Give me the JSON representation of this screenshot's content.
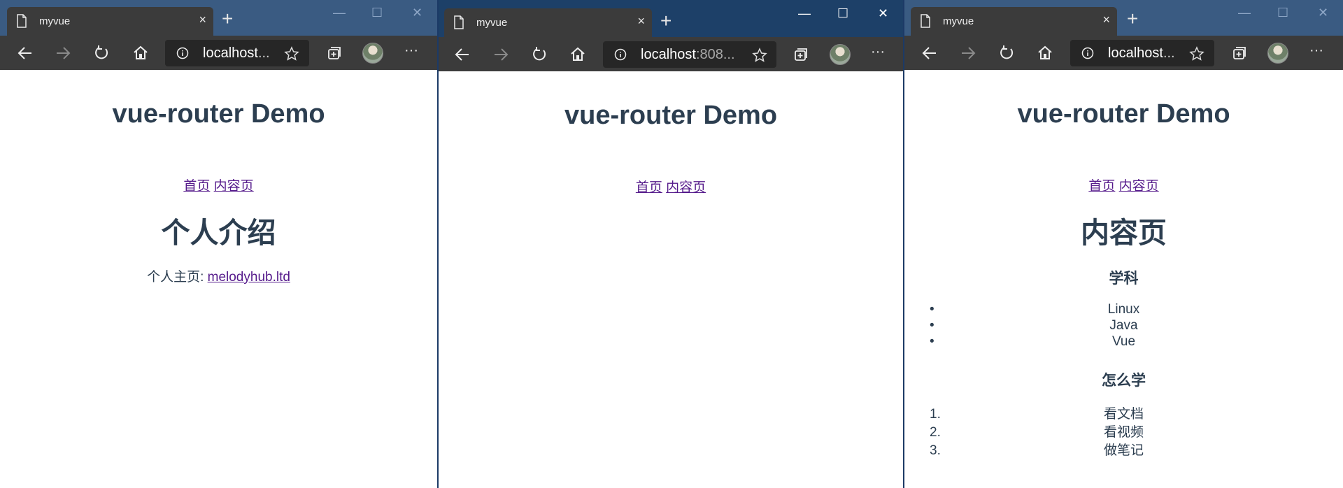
{
  "browser": {
    "tab_title": "myvue",
    "new_tab_symbol": "+",
    "tab_close_symbol": "×",
    "window_controls": {
      "minimize": "—",
      "maximize": "☐",
      "close": "✕"
    },
    "more_symbol": "···",
    "colors": {
      "titlebar_inactive": "#3a5b82",
      "titlebar_active": "#1d4068",
      "toolbar": "#3b3b3b",
      "addressbar": "#262626"
    }
  },
  "windows": [
    {
      "url": "localhost...",
      "url_host": "localhost",
      "url_rest": "...",
      "active": false
    },
    {
      "url": "localhost:808...",
      "url_host": "localhost",
      "url_rest": ":808...",
      "active": true
    },
    {
      "url": "localhost...",
      "url_host": "localhost",
      "url_rest": "...",
      "active": false
    }
  ],
  "app": {
    "title": "vue-router Demo",
    "nav": {
      "home": "首页",
      "content": "内容页"
    },
    "link_color": "#551a8b",
    "text_color": "#2c3e50"
  },
  "home_page": {
    "heading": "个人介绍",
    "homepage_label": "个人主页: ",
    "homepage_link": "melodyhub.ltd"
  },
  "content_page": {
    "heading": "内容页",
    "subjects_heading": "学科",
    "subjects": [
      "Linux",
      "Java",
      "Vue"
    ],
    "howto_heading": "怎么学",
    "howto_markers": [
      "1.",
      "2.",
      "3."
    ],
    "howto": [
      "看文档",
      "看视频",
      "做笔记"
    ]
  }
}
